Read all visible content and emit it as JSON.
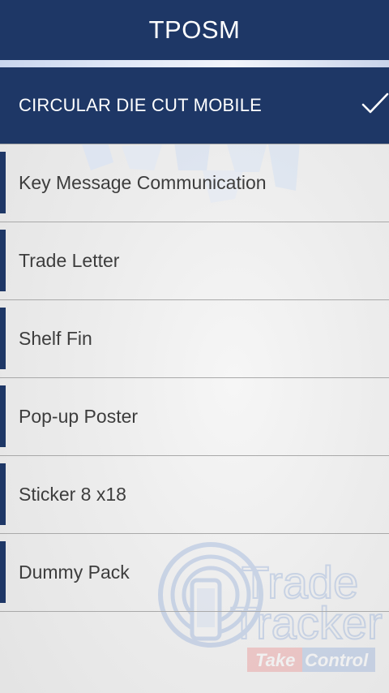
{
  "app_bar": {
    "title": "TPOSM"
  },
  "selected_item": {
    "label": "CIRCULAR DIE CUT MOBILE",
    "icon": "check-icon"
  },
  "items": [
    {
      "label": "Key Message Communication"
    },
    {
      "label": "Trade Letter"
    },
    {
      "label": "Shelf Fin"
    },
    {
      "label": "Pop-up Poster"
    },
    {
      "label": "Sticker 8 x18"
    },
    {
      "label": "Dummy Pack"
    }
  ],
  "watermark": {
    "line1": "Trade",
    "line2": "Tracker",
    "tagline_part1": "Take",
    "tagline_part2": "Control"
  },
  "colors": {
    "primary": "#1e3766",
    "text": "#3d3d3d",
    "divider": "#a9a9a9",
    "watermark_red": "#e87a7a",
    "watermark_blue": "#7f9fd4"
  }
}
